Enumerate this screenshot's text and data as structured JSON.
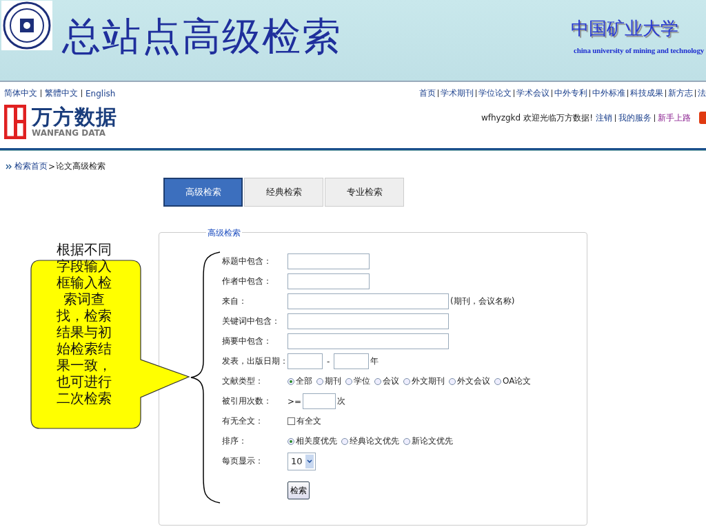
{
  "header": {
    "title": "总站点高级检索",
    "university": "中国矿业大学",
    "university_en": "china university of mining and technology"
  },
  "language_links": [
    "简体中文",
    "繁體中文",
    "English"
  ],
  "brand": {
    "name": "万方数据",
    "subtitle": "WANFANG DATA"
  },
  "nav_links": [
    "首页",
    "学术期刊",
    "学位论文",
    "学术会议",
    "中外专利",
    "中外标准",
    "科技成果",
    "新方志",
    "法"
  ],
  "user_bar": {
    "username": "wfhyzgkd",
    "welcome": "欢迎光临万方数据!",
    "links": [
      "注销",
      "我的服务",
      "新手上路"
    ]
  },
  "breadcrumb": {
    "home": "检索首页",
    "separator": ">",
    "current": "论文高级检索"
  },
  "tabs": [
    {
      "label": "高级检索",
      "selected": true
    },
    {
      "label": "经典检索",
      "selected": false
    },
    {
      "label": "专业检索",
      "selected": false
    }
  ],
  "form": {
    "legend": "高级检索",
    "rows": [
      {
        "kind": "short",
        "label": "标题中包含："
      },
      {
        "kind": "short",
        "label": "作者中包含："
      },
      {
        "kind": "long",
        "label": "来自：",
        "note": "(期刊，会议名称)"
      },
      {
        "kind": "long",
        "label": "关键词中包含："
      },
      {
        "kind": "long",
        "label": "摘要中包含："
      },
      {
        "kind": "date",
        "label": "发表，出版日期：",
        "separator": "-",
        "unit": "年"
      },
      {
        "kind": "radio",
        "label": "文献类型：",
        "options": [
          {
            "label": "全部",
            "selected": true
          },
          {
            "label": "期刊",
            "selected": false
          },
          {
            "label": "学位",
            "selected": false
          },
          {
            "label": "会议",
            "selected": false
          },
          {
            "label": "外文期刊",
            "selected": false
          },
          {
            "label": "外文会议",
            "selected": false
          },
          {
            "label": "OA论文",
            "selected": false
          }
        ]
      },
      {
        "kind": "count",
        "label": "被引用次数：",
        "prefix": ">=",
        "unit": "次"
      },
      {
        "kind": "checkbox",
        "label": "有无全文：",
        "option": {
          "label": "有全文",
          "checked": false
        }
      },
      {
        "kind": "radio",
        "label": "排序：",
        "options": [
          {
            "label": "相关度优先",
            "selected": true
          },
          {
            "label": "经典论文优先",
            "selected": false
          },
          {
            "label": "新论文优先",
            "selected": false
          }
        ]
      },
      {
        "kind": "select",
        "label": "每页显示：",
        "value": "10"
      }
    ],
    "submit": "检索"
  },
  "callout": {
    "text": "根据不同字段输入框输入检索词查找，检索结果与初始检索结果一致，也可进行二次检索"
  }
}
